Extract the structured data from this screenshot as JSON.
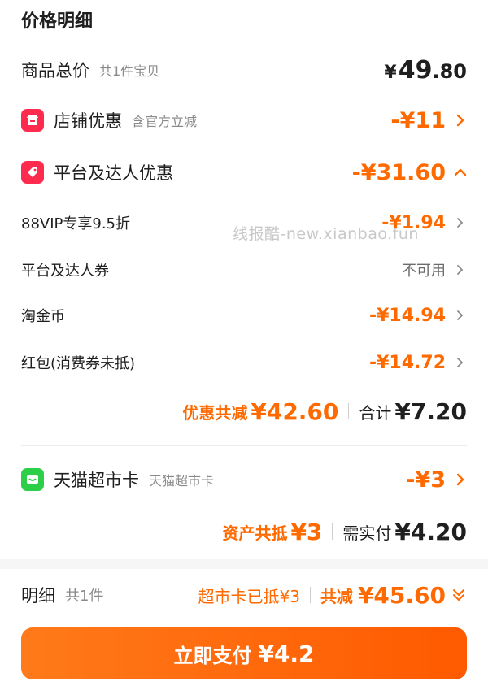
{
  "title": "价格明细",
  "goods_total": {
    "label": "商品总价",
    "sub": "共1件宝贝",
    "yen": "¥",
    "int": "49",
    "dec": ".80"
  },
  "shop_discount": {
    "label": "店铺优惠",
    "sub": "含官方立减",
    "amount": "-¥11"
  },
  "platform_discount": {
    "label": "平台及达人优惠",
    "amount": "-¥31.60"
  },
  "items": [
    {
      "label": "88VIP专享9.5折",
      "amount": "-¥1.94"
    },
    {
      "label": "平台及达人券",
      "amount": "不可用"
    },
    {
      "label": "淘金币",
      "amount": "-¥14.94"
    },
    {
      "label": "红包(消费券未抵)",
      "amount": "-¥14.72"
    }
  ],
  "subtotal1": {
    "discount_label": "优惠共减",
    "discount_value": "¥42.60",
    "total_label": "合计",
    "total_value": "¥7.20"
  },
  "tmall_card": {
    "label": "天猫超市卡",
    "sub": "天猫超市卡",
    "amount": "-¥3"
  },
  "subtotal2": {
    "asset_label": "资产共抵",
    "asset_value": "¥3",
    "pay_label": "需实付",
    "pay_value": "¥4.20"
  },
  "watermark": "线报酷-new.xianbao.fun",
  "footer": {
    "detail_label": "明细",
    "detail_count": "共1件",
    "card_used": "超市卡已抵¥3",
    "total_label": "共减",
    "total_value": "¥45.60"
  },
  "pay_button": {
    "label": "立即支付",
    "amount": "¥4.2"
  },
  "colors": {
    "accent": "#ff6a00",
    "shop_icon": "#ff2b4e",
    "card_icon": "#2ecf48"
  }
}
